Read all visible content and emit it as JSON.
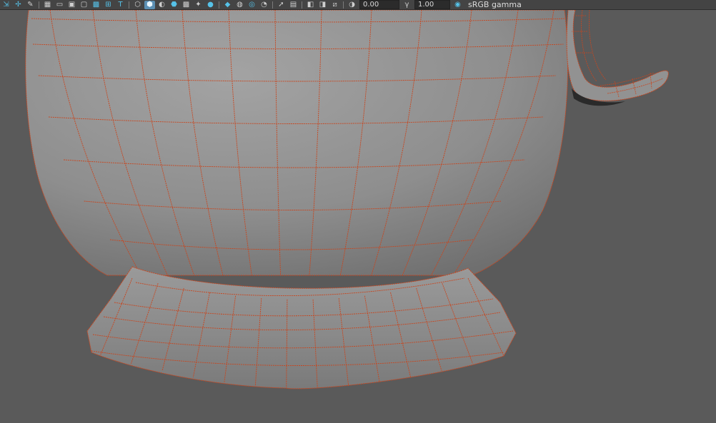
{
  "toolbar": {
    "buttons": [
      {
        "icon": "snap-together-icon"
      },
      {
        "icon": "move-pivot-icon"
      },
      {
        "icon": "paint-tool-icon"
      },
      {
        "icon": "grid-icon"
      },
      {
        "icon": "film-gate-icon"
      },
      {
        "icon": "resolution-gate-icon"
      },
      {
        "icon": "gate-mask-icon"
      },
      {
        "icon": "field-chart-icon"
      },
      {
        "icon": "safe-action-icon"
      },
      {
        "icon": "safe-title-icon"
      },
      {
        "icon": "wireframe-icon"
      },
      {
        "icon": "smooth-shade-icon",
        "active": true
      },
      {
        "icon": "default-material-icon"
      },
      {
        "icon": "wireframe-on-shaded-icon"
      },
      {
        "icon": "textured-icon"
      },
      {
        "icon": "use-all-lights-icon"
      },
      {
        "icon": "shadows-icon"
      },
      {
        "icon": "screen-space-ao-icon"
      },
      {
        "icon": "motion-blur-icon"
      },
      {
        "icon": "multisample-aa-icon"
      },
      {
        "icon": "depth-of-field-icon"
      },
      {
        "icon": "isolate-select-icon"
      },
      {
        "icon": "xray-icon"
      },
      {
        "icon": "xray-active-components-icon"
      },
      {
        "icon": "xray-joints-icon"
      },
      {
        "icon": "camera-attributes-icon"
      },
      {
        "icon": "exposure-icon"
      }
    ],
    "exposure_value": "0.00",
    "gamma_icon": "gamma-icon",
    "gamma_value": "1.00",
    "view_transform_icon": "view-transform-toggle-icon",
    "color_space": "sRGB gamma"
  },
  "viewport": {
    "background": "#5a5a5a",
    "mesh_color": "#8f8f8f",
    "wireframe_color": "#c8461f"
  }
}
